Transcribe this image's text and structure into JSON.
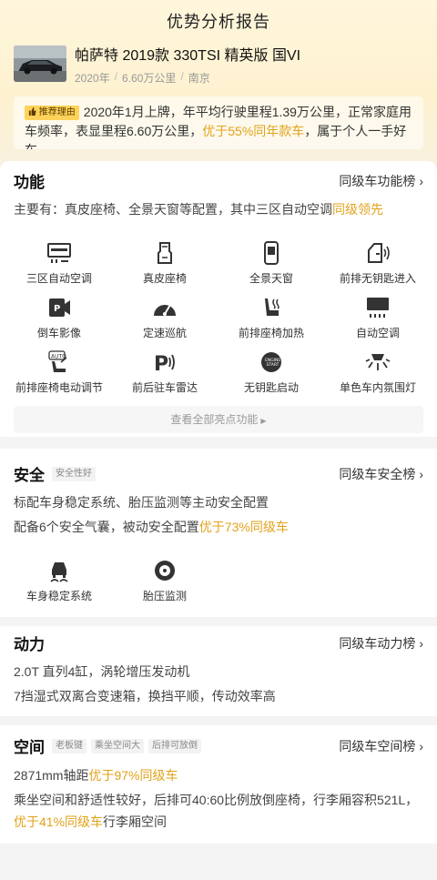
{
  "page_title": "优势分析报告",
  "car": {
    "name": "帕萨特 2019款 330TSI 精英版 国VI",
    "year": "2020年",
    "mileage": "6.60万公里",
    "city": "南京"
  },
  "reason": {
    "tag": "推荐理由",
    "text_before": "2020年1月上牌，年平均行驶里程1.39万公里，正常家庭用车频率，表显里程6.60万公里，",
    "highlight": "优于55%同年款车",
    "text_after": "，属于个人一手好车"
  },
  "features": {
    "title": "功能",
    "rank_link": "同级车功能榜",
    "summary_before": "主要有：真皮座椅、全景天窗等配置，其中三区自动空调",
    "summary_highlight": "同级领先",
    "items": [
      {
        "label": "三区自动空调",
        "icon": "ac-panel-icon"
      },
      {
        "label": "真皮座椅",
        "icon": "seat-icon"
      },
      {
        "label": "全景天窗",
        "icon": "sunroof-icon"
      },
      {
        "label": "前排无钥匙进入",
        "icon": "keyless-door-icon"
      },
      {
        "label": "倒车影像",
        "icon": "camera-icon"
      },
      {
        "label": "定速巡航",
        "icon": "cruise-gauge-icon"
      },
      {
        "label": "前排座椅加热",
        "icon": "seat-heat-icon"
      },
      {
        "label": "自动空调",
        "icon": "auto-ac-icon"
      },
      {
        "label": "前排座椅电动调节",
        "icon": "seat-auto-icon"
      },
      {
        "label": "前后驻车雷达",
        "icon": "parking-radar-icon"
      },
      {
        "label": "无钥匙启动",
        "icon": "start-button-icon"
      },
      {
        "label": "单色车内氛围灯",
        "icon": "ambient-light-icon"
      }
    ],
    "more_label": "查看全部亮点功能"
  },
  "safety": {
    "title": "安全",
    "chip": "安全性好",
    "rank_link": "同级车安全榜",
    "line1": "标配车身稳定系统、胎压监测等主动安全配置",
    "line2_before": "配备6个安全气囊，被动安全配置",
    "line2_highlight": "优于73%同级车",
    "items": [
      {
        "label": "车身稳定系统",
        "icon": "esp-icon"
      },
      {
        "label": "胎压监测",
        "icon": "tire-icon"
      }
    ]
  },
  "power": {
    "title": "动力",
    "rank_link": "同级车动力榜",
    "line1": "2.0T 直列4缸，涡轮增压发动机",
    "line2": "7挡湿式双离合变速箱，换挡平顺，传动效率高"
  },
  "space": {
    "title": "空间",
    "chips": [
      "老板键",
      "乘坐空间大",
      "后排可放倒"
    ],
    "rank_link": "同级车空间榜",
    "line1_before": "2871mm轴距",
    "line1_highlight": "优于97%同级车",
    "line2_before": "乘坐空间和舒适性较好，后排可40:60比例放倒座椅，行李厢容积521L，",
    "line2_highlight": "优于41%同级车",
    "line2_after": "行李厢空间"
  },
  "colors": {
    "accent": "#e2a21a",
    "tag_bg": "#ffd25a",
    "hero_bg": "#fff6dc"
  }
}
